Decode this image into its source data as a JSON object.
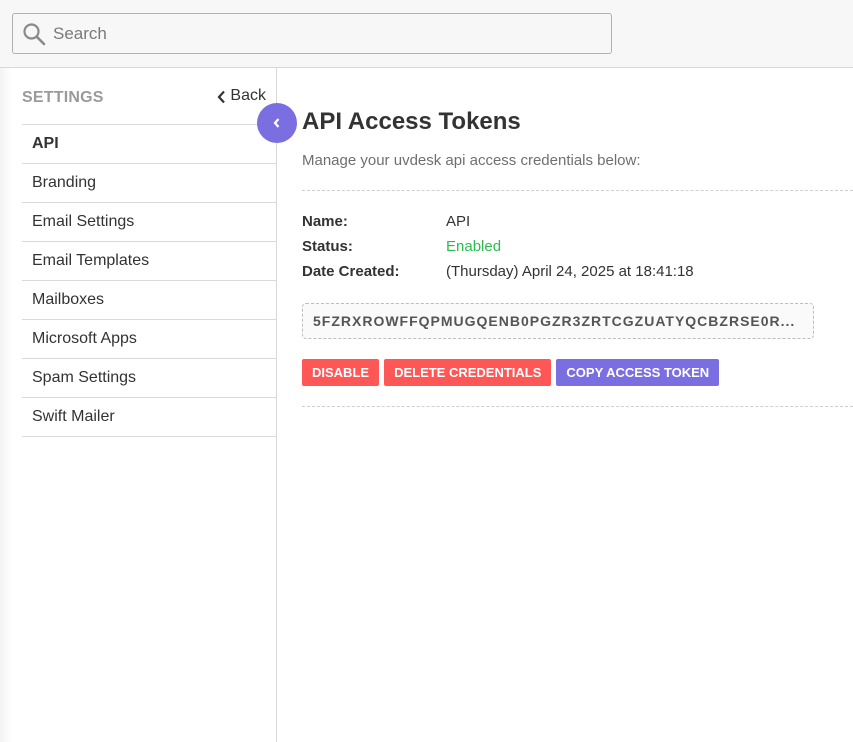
{
  "search": {
    "placeholder": "Search",
    "icon": "search-icon"
  },
  "sidebar": {
    "title": "SETTINGS",
    "back_label": "Back",
    "items": [
      {
        "label": "API",
        "active": true
      },
      {
        "label": "Branding"
      },
      {
        "label": "Email Settings"
      },
      {
        "label": "Email Templates"
      },
      {
        "label": "Mailboxes"
      },
      {
        "label": "Microsoft Apps"
      },
      {
        "label": "Spam Settings"
      },
      {
        "label": "Swift Mailer"
      }
    ]
  },
  "main": {
    "title": "API Access Tokens",
    "subtitle": "Manage your uvdesk api access credentials below:",
    "details": {
      "name_label": "Name:",
      "name_value": "API",
      "status_label": "Status:",
      "status_value": "Enabled",
      "date_label": "Date Created:",
      "date_value": "(Thursday) April 24, 2025 at 18:41:18"
    },
    "token": "5FZRXROWFFQPMUGQENB0PGZR3ZRTCGZUATYQCBZRSE0R...",
    "buttons": {
      "disable": "DISABLE",
      "delete": "DELETE CREDENTIALS",
      "copy": "COPY ACCESS TOKEN"
    }
  },
  "colors": {
    "accent": "#7b6ee0",
    "danger": "#ff5656",
    "success": "#2dbb4f"
  }
}
